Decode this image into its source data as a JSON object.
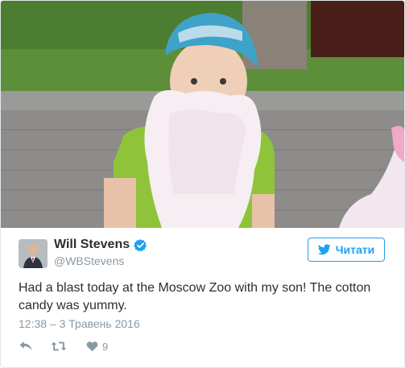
{
  "tweet": {
    "author_name": "Will Stevens",
    "handle": "@WBStevens",
    "verified": true,
    "text": "Had a blast today at the Moscow Zoo with my son! The cotton candy was yummy.",
    "timestamp": "12:38 – 3 Травень 2016",
    "like_count": "9"
  },
  "follow_button": {
    "label": "Читати",
    "icon": "twitter-bird-icon"
  },
  "actions": [
    {
      "name": "reply",
      "icon": "reply-icon"
    },
    {
      "name": "retweet",
      "icon": "retweet-icon"
    },
    {
      "name": "like",
      "icon": "heart-icon"
    }
  ],
  "colors": {
    "accent": "#1da1f2",
    "text": "#292f33",
    "muted": "#8899a6",
    "border": "#e1e8ed"
  }
}
